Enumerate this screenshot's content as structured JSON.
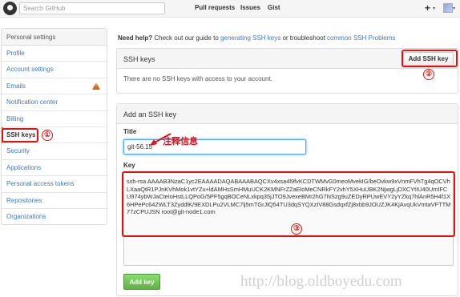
{
  "header": {
    "search_placeholder": "Search GitHub",
    "nav": [
      "Pull requests",
      "Issues",
      "Gist"
    ],
    "plus_icon": "plus-icon",
    "caret_glyph": "▾"
  },
  "sidebar": {
    "heading": "Personal settings",
    "items": [
      {
        "label": "Profile"
      },
      {
        "label": "Account settings"
      },
      {
        "label": "Emails",
        "icon": "warning-icon"
      },
      {
        "label": "Notification center"
      },
      {
        "label": "Billing"
      },
      {
        "label": "SSH keys",
        "active": true
      },
      {
        "label": "Security"
      },
      {
        "label": "Applications"
      },
      {
        "label": "Personal access tokens"
      },
      {
        "label": "Repositories"
      },
      {
        "label": "Organizations"
      }
    ]
  },
  "help": {
    "lead": "Need help?",
    "text1": " Check out our guide to ",
    "link1": "generating SSH keys",
    "text2": " or troubleshoot ",
    "link2": "common SSH Problems"
  },
  "ssh_keys": {
    "title": "SSH keys",
    "add_button": "Add SSH key",
    "empty_text": "There are no SSH keys with access to your account."
  },
  "add_key": {
    "heading": "Add an SSH key",
    "title_label": "Title",
    "title_value": "git-56.15",
    "key_label": "Key",
    "key_value": "ssh-rsa AAAAB3NzaC1yc2EAAAADAQABAAABAQCXv4xsa4l9fvKCDTWMvG0meoMvekIG/beOvkw9xVnmFVhTg4qOCVhLXaaQtR1PJnKVhMok1vtYZu+ldAMHsSmHMuUCK2KMNFrZZaEloMeCNRkFY2vhY5XHuUBK2NjwgLjDXCYtIU40UmIFCU974ybWJaCteIoHstLLQPoG/5PF5gqBOCeNLxkpq35jJTO9JvexeBMr2hG7NSzg9uZEDyRPUwEVY2yYZkq7hlAnR5H4f1X6HPePc64ZWLT3ZyddlK/9EXDLPu2VLMC7lj5mTGrJlQ54TU3dqSYQXzIV88GsdqxfZj8xbb9JOUZJK4KjAvqUkVmtaVFTTM77zCPUJSN root@git-node1.com",
    "submit": "Add key"
  },
  "annotations": {
    "n1": "①",
    "n2": "②",
    "n3": "③",
    "note": "注释信息",
    "watermark": "http://blog.oldboyedu.com"
  },
  "colors": {
    "accent": "#e21212",
    "link": "#4078c0",
    "primary_button": "#60b044"
  }
}
